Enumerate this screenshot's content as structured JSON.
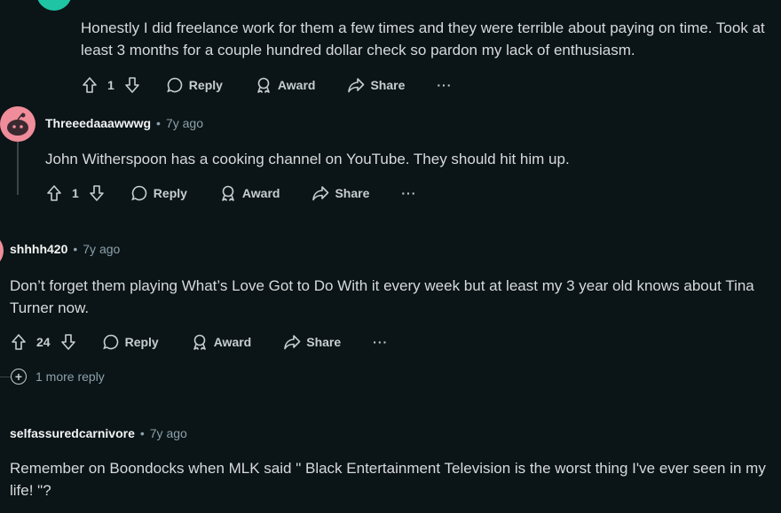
{
  "comments": [
    {
      "body": "Honestly I did freelance work for them a few times and they were terrible about paying on time. Took at least 3 months for a couple hundred dollar check so pardon my lack of enthusiasm.",
      "score": "1",
      "reply": "Reply",
      "award": "Award",
      "share": "Share",
      "more": "···"
    },
    {
      "author": "Threeedaaawwwg",
      "time": "7y ago",
      "body": "John Witherspoon has a cooking channel on YouTube. They should hit him up.",
      "score": "1",
      "reply": "Reply",
      "award": "Award",
      "share": "Share",
      "more": "···"
    },
    {
      "author": "shhhh420",
      "time": "7y ago",
      "body": "Don’t forget them playing What’s Love Got to Do With it every week but at least my 3 year old knows about Tina Turner now.",
      "score": "24",
      "reply": "Reply",
      "award": "Award",
      "share": "Share",
      "more": "···",
      "more_replies": "1 more reply"
    },
    {
      "author": "selfassuredcarnivore",
      "time": "7y ago",
      "body": "Remember on Boondocks when MLK said \" Black Entertainment Television is the worst thing I've ever seen in my life! \"?"
    }
  ],
  "separator": "•",
  "colors": {
    "background": "#0b1416",
    "text": "#d7dadc",
    "muted": "#8ba2ad",
    "avatar_pink": "#f08d9b",
    "avatar_teal": "#1fc4a4"
  }
}
